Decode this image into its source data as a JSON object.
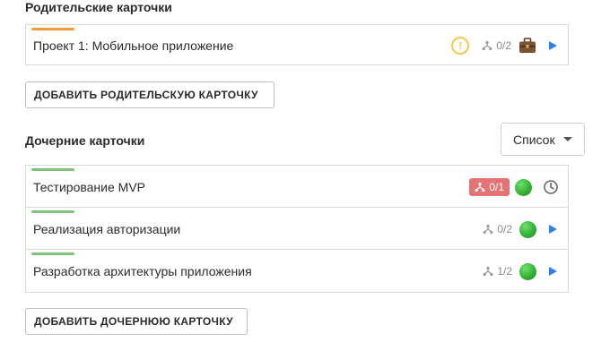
{
  "parent_section": {
    "title": "Родительские карточки",
    "cards": [
      {
        "title": "Проект 1: Мобильное приложение",
        "stripe_color": "#f39c3c",
        "subtasks": "0/2",
        "icons": [
          "warning-icon",
          "subtasks-icon",
          "briefcase-icon",
          "play-icon"
        ]
      }
    ],
    "add_button": "ДОБАВИТЬ РОДИТЕЛЬСКУЮ КАРТОЧКУ"
  },
  "child_section": {
    "title": "Дочерние карточки",
    "view_select": {
      "value": "Список"
    },
    "cards": [
      {
        "title": "Тестирование MVP",
        "stripe_color": "#7cc47c",
        "subtasks": "0/1",
        "subtasks_alert": true,
        "status_color": "#33b233",
        "icons": [
          "subtasks-icon",
          "green-status-icon",
          "clock-icon"
        ]
      },
      {
        "title": "Реализация авторизации",
        "stripe_color": "#7cc47c",
        "subtasks": "0/2",
        "subtasks_alert": false,
        "status_color": "#33b233",
        "icons": [
          "subtasks-icon",
          "green-status-icon",
          "play-icon"
        ]
      },
      {
        "title": "Разработка архитектуры приложения",
        "stripe_color": "#7cc47c",
        "subtasks": "1/2",
        "subtasks_alert": false,
        "status_color": "#33b233",
        "icons": [
          "subtasks-icon",
          "green-status-icon",
          "play-icon"
        ]
      }
    ],
    "add_button": "ДОБАВИТЬ ДОЧЕРНЮЮ КАРТОЧКУ"
  },
  "colors": {
    "accent_blue": "#2f80ed",
    "alert_red": "#e57373",
    "warning_yellow": "#f2c94c",
    "border": "#d9d9d9"
  }
}
